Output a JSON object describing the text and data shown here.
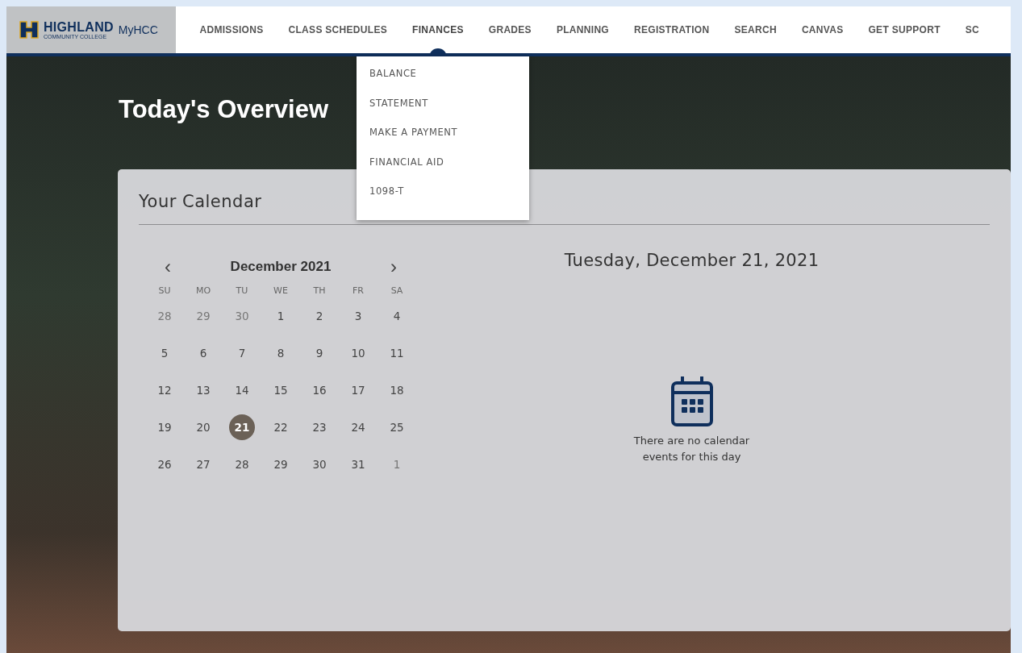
{
  "logo": {
    "name": "HIGHLAND",
    "subtitle": "COMMUNITY COLLEGE",
    "app": "MyHCC"
  },
  "nav": [
    {
      "label": "ADMISSIONS",
      "selected": false
    },
    {
      "label": "CLASS SCHEDULES",
      "selected": false
    },
    {
      "label": "FINANCES",
      "selected": true
    },
    {
      "label": "GRADES",
      "selected": false
    },
    {
      "label": "PLANNING",
      "selected": false
    },
    {
      "label": "REGISTRATION",
      "selected": false
    },
    {
      "label": "SEARCH",
      "selected": false
    },
    {
      "label": "CANVAS",
      "selected": false
    },
    {
      "label": "GET SUPPORT",
      "selected": false
    },
    {
      "label": "SC",
      "selected": false
    }
  ],
  "dropdown": [
    "BALANCE",
    "STATEMENT",
    "MAKE A PAYMENT",
    "FINANCIAL AID",
    "1098-T"
  ],
  "page_title": "Today's Overview",
  "calendar_card": {
    "title": "Your Calendar",
    "month": "December 2021",
    "prev": "‹",
    "next": "›",
    "weekdays": [
      "SU",
      "MO",
      "TU",
      "WE",
      "TH",
      "FR",
      "SA"
    ],
    "weeks": [
      [
        {
          "day": "28",
          "muted": true,
          "selected": false
        },
        {
          "day": "29",
          "muted": true,
          "selected": false
        },
        {
          "day": "30",
          "muted": true,
          "selected": false
        },
        {
          "day": "1",
          "muted": false,
          "selected": false
        },
        {
          "day": "2",
          "muted": false,
          "selected": false
        },
        {
          "day": "3",
          "muted": false,
          "selected": false
        },
        {
          "day": "4",
          "muted": false,
          "selected": false
        }
      ],
      [
        {
          "day": "5",
          "muted": false,
          "selected": false
        },
        {
          "day": "6",
          "muted": false,
          "selected": false
        },
        {
          "day": "7",
          "muted": false,
          "selected": false
        },
        {
          "day": "8",
          "muted": false,
          "selected": false
        },
        {
          "day": "9",
          "muted": false,
          "selected": false
        },
        {
          "day": "10",
          "muted": false,
          "selected": false
        },
        {
          "day": "11",
          "muted": false,
          "selected": false
        }
      ],
      [
        {
          "day": "12",
          "muted": false,
          "selected": false
        },
        {
          "day": "13",
          "muted": false,
          "selected": false
        },
        {
          "day": "14",
          "muted": false,
          "selected": false
        },
        {
          "day": "15",
          "muted": false,
          "selected": false
        },
        {
          "day": "16",
          "muted": false,
          "selected": false
        },
        {
          "day": "17",
          "muted": false,
          "selected": false
        },
        {
          "day": "18",
          "muted": false,
          "selected": false
        }
      ],
      [
        {
          "day": "19",
          "muted": false,
          "selected": false
        },
        {
          "day": "20",
          "muted": false,
          "selected": false
        },
        {
          "day": "21",
          "muted": false,
          "selected": true
        },
        {
          "day": "22",
          "muted": false,
          "selected": false
        },
        {
          "day": "23",
          "muted": false,
          "selected": false
        },
        {
          "day": "24",
          "muted": false,
          "selected": false
        },
        {
          "day": "25",
          "muted": false,
          "selected": false
        }
      ],
      [
        {
          "day": "26",
          "muted": false,
          "selected": false
        },
        {
          "day": "27",
          "muted": false,
          "selected": false
        },
        {
          "day": "28",
          "muted": false,
          "selected": false
        },
        {
          "day": "29",
          "muted": false,
          "selected": false
        },
        {
          "day": "30",
          "muted": false,
          "selected": false
        },
        {
          "day": "31",
          "muted": false,
          "selected": false
        },
        {
          "day": "1",
          "muted": true,
          "selected": false
        }
      ]
    ],
    "selected_date": "Tuesday, December 21, 2021",
    "empty_message": "There are no calendar events for this day"
  }
}
